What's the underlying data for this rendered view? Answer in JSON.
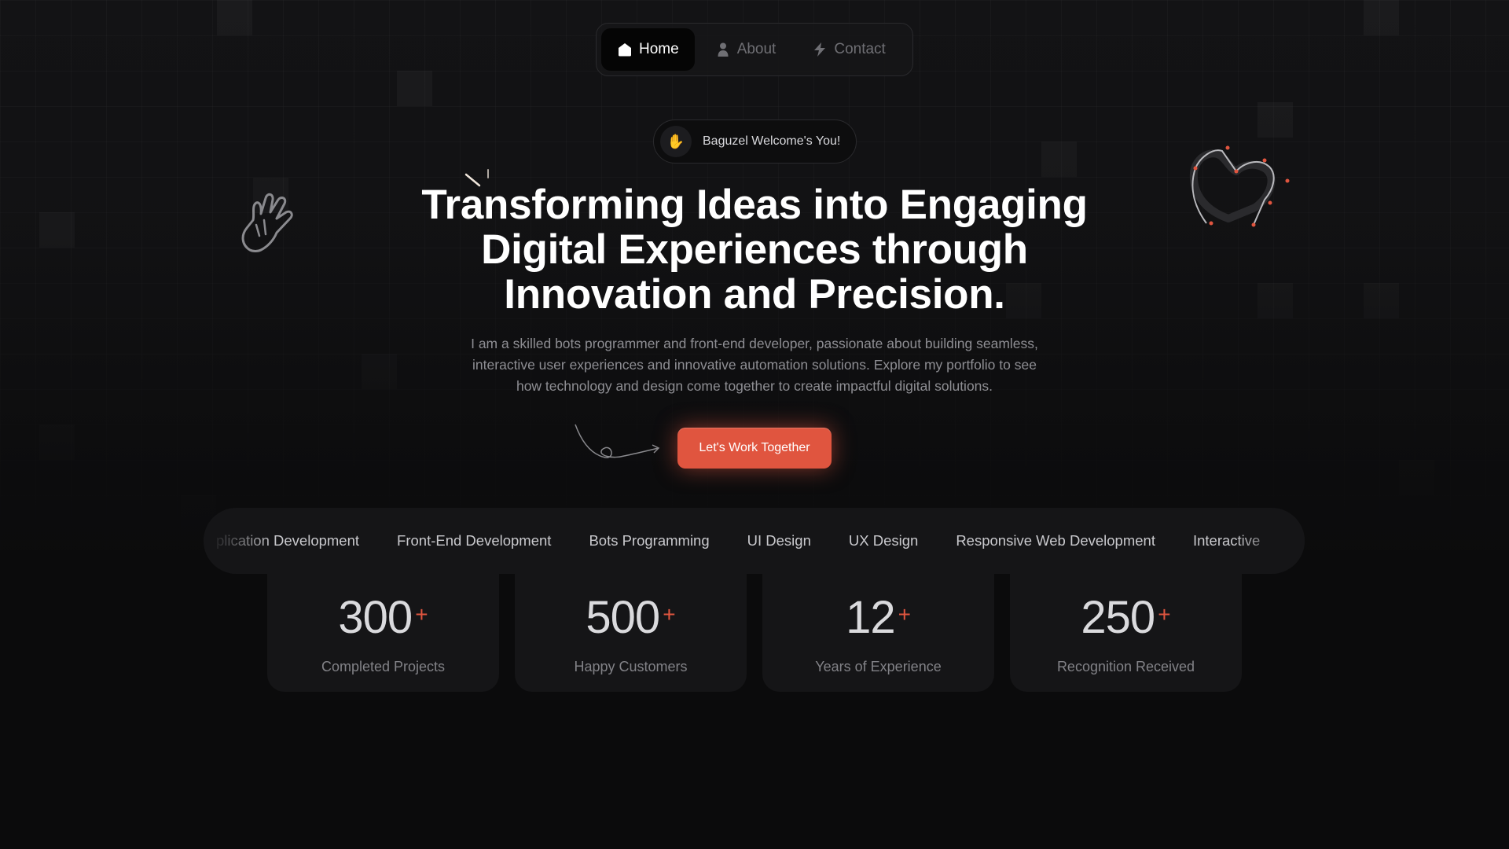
{
  "nav": {
    "items": [
      {
        "label": "Home",
        "icon": "home-icon",
        "active": true
      },
      {
        "label": "About",
        "icon": "user-icon",
        "active": false
      },
      {
        "label": "Contact",
        "icon": "bolt-icon",
        "active": false
      }
    ]
  },
  "welcome": {
    "icon": "waving-hand-icon",
    "emoji": "✋",
    "text": "Baguzel Welcome's You!"
  },
  "hero": {
    "title_lines": [
      "Transforming Ideas into Engaging",
      "Digital Experiences through",
      "Innovation and Precision."
    ],
    "subtitle_lines": [
      "I am a skilled bots programmer and front-end developer, passionate about building seamless,",
      "interactive user experiences and innovative automation solutions. Explore my portfolio to see",
      "how technology and design come together to create impactful digital solutions."
    ],
    "cta_label": "Let's Work Together"
  },
  "skills": [
    "plication Development",
    "Front-End Development",
    "Bots Programming",
    "UI Design",
    "UX Design",
    "Responsive Web Development",
    "Interactive"
  ],
  "stats": [
    {
      "value": "300",
      "suffix": "+",
      "label": "Completed Projects"
    },
    {
      "value": "500",
      "suffix": "+",
      "label": "Happy Customers"
    },
    {
      "value": "12",
      "suffix": "+",
      "label": "Years of Experience"
    },
    {
      "value": "250",
      "suffix": "+",
      "label": "Recognition Received"
    }
  ],
  "colors": {
    "accent": "#e0553f",
    "background": "#0b0b0c",
    "card": "#151517"
  }
}
